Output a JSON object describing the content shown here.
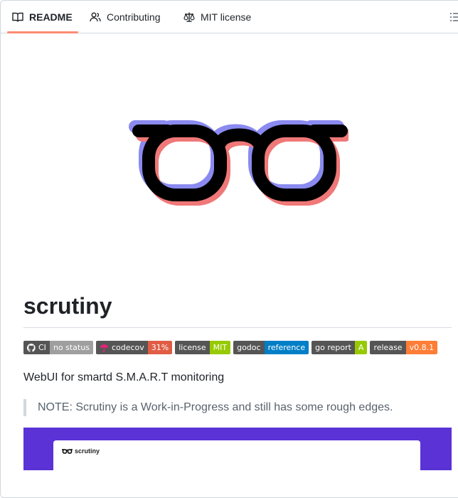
{
  "tabs": [
    {
      "label": "README",
      "icon": "book-icon",
      "active": true
    },
    {
      "label": "Contributing",
      "icon": "people-icon",
      "active": false
    },
    {
      "label": "MIT license",
      "icon": "law-scale-icon",
      "active": false
    }
  ],
  "outline_icon": "list-unordered-icon",
  "logo_icon": "glasses-icon",
  "title": "scrutiny",
  "badges": [
    {
      "left": "CI",
      "right": "no status",
      "icon": "github-icon"
    },
    {
      "left": "codecov",
      "right": "31%",
      "icon": "codecov-umbrella-icon"
    },
    {
      "left": "license",
      "right": "MIT"
    },
    {
      "left": "godoc",
      "right": "reference"
    },
    {
      "left": "go report",
      "right": "A"
    },
    {
      "left": "release",
      "right": "v0.8.1"
    }
  ],
  "description": "WebUI for smartd S.M.A.R.T monitoring",
  "note": "NOTE: Scrutiny is a Work-in-Progress and still has some rough edges.",
  "screenshot": {
    "app_name": "scrutiny",
    "background": "#5b32d6"
  },
  "colors": {
    "accent_underline": "#fd8c73",
    "glasses_blue": "#8a8af0",
    "glasses_red": "#f07878"
  }
}
